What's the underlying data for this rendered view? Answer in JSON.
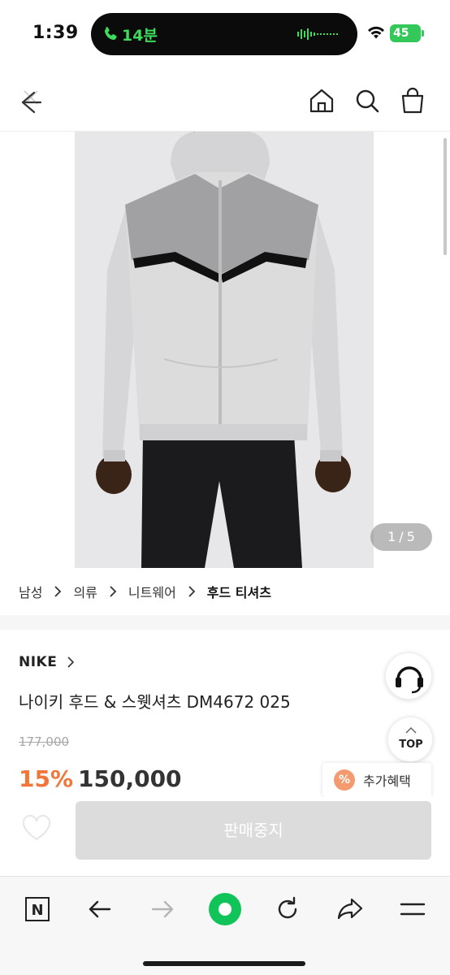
{
  "status_bar": {
    "time": "1:39",
    "call_duration": "14분",
    "battery_level": "45",
    "call_color": "#3ddc5c",
    "battery_color": "#34c759"
  },
  "header": {
    "icons": [
      "back-icon",
      "home-icon",
      "search-icon",
      "shopping-bag-icon"
    ]
  },
  "gallery": {
    "current_page": "1",
    "separator": "/",
    "total_pages": "5"
  },
  "breadcrumb": {
    "items": [
      "남성",
      "의류",
      "니트웨어",
      "후드 티셔츠"
    ]
  },
  "product": {
    "brand": "NIKE",
    "name": "나이키 후드 & 스웻셔츠 DM4672 025",
    "original_price": "177,000",
    "discount_rate": "15%",
    "sale_price": "150,000",
    "discount_color": "#f0763a"
  },
  "floating": {
    "top_label": "TOP",
    "benefit_icon": "%",
    "benefit_label": "추가혜택"
  },
  "action_bar": {
    "buy_label": "판매중지"
  },
  "browser_toolbar": {
    "n_label": "N",
    "accent_color": "#10c45a"
  }
}
